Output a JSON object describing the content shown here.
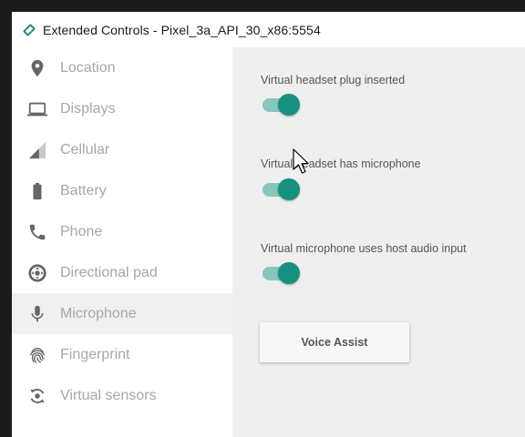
{
  "window": {
    "title": "Extended Controls - Pixel_3a_API_30_x86:5554"
  },
  "sidebar": {
    "items": [
      {
        "label": "Location",
        "icon": "location-pin-icon",
        "active": false
      },
      {
        "label": "Displays",
        "icon": "laptop-icon",
        "active": false
      },
      {
        "label": "Cellular",
        "icon": "signal-icon",
        "active": false
      },
      {
        "label": "Battery",
        "icon": "battery-icon",
        "active": false
      },
      {
        "label": "Phone",
        "icon": "phone-icon",
        "active": false
      },
      {
        "label": "Directional pad",
        "icon": "dpad-icon",
        "active": false
      },
      {
        "label": "Microphone",
        "icon": "microphone-icon",
        "active": true
      },
      {
        "label": "Fingerprint",
        "icon": "fingerprint-icon",
        "active": false
      },
      {
        "label": "Virtual sensors",
        "icon": "rotate-sensor-icon",
        "active": false
      }
    ]
  },
  "microphone": {
    "settings": [
      {
        "label": "Virtual headset plug inserted",
        "enabled": true
      },
      {
        "label": "Virtual headset has microphone",
        "enabled": true
      },
      {
        "label": "Virtual microphone uses host audio input",
        "enabled": true
      }
    ],
    "voice_assist_label": "Voice Assist"
  },
  "colors": {
    "accent": "#16907f",
    "accent_track": "#86c6bd",
    "sidebar_text": "#a7a7a7",
    "icon": "#666666",
    "active_bg": "#f0f0f0"
  }
}
